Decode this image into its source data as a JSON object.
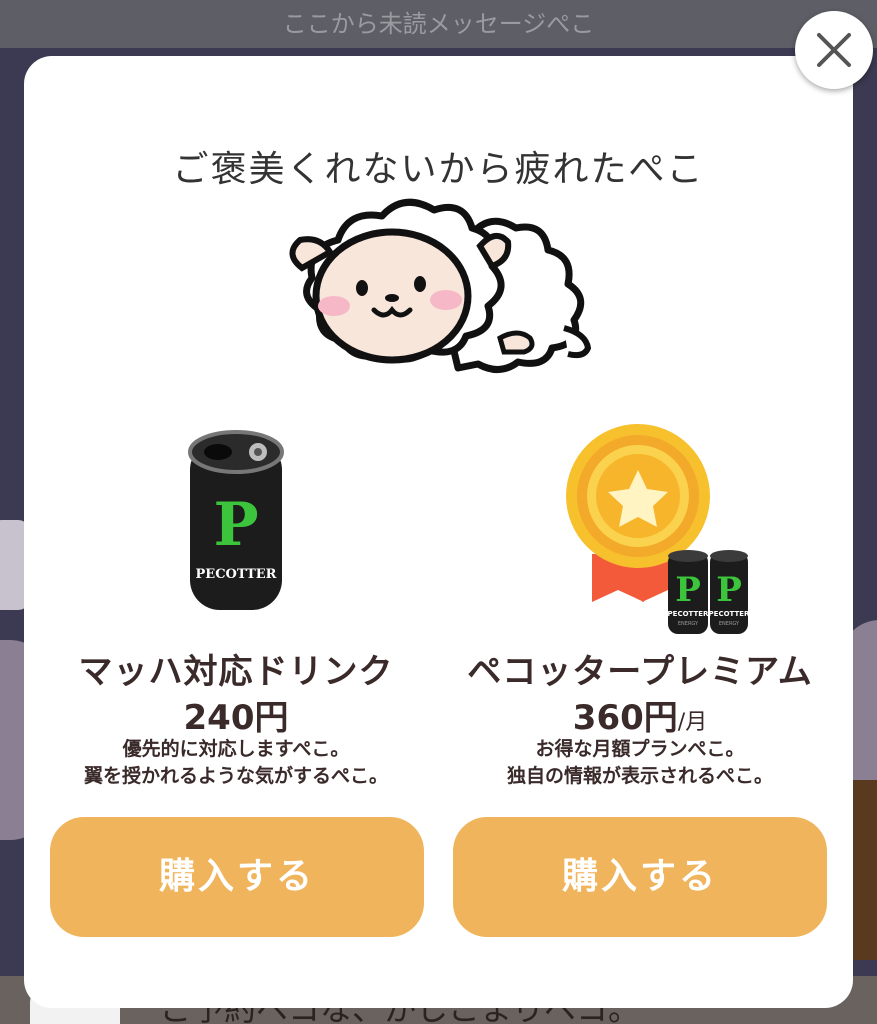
{
  "background": {
    "unread_banner": "ここから未読メッセージぺこ",
    "bottom_message": "ご予約ペコな、かしこまりペコ。"
  },
  "modal": {
    "title": "ご褒美くれないから疲れたぺこ",
    "close_icon": "close-icon",
    "products": [
      {
        "name": "マッハ対応ドリンク",
        "price": "240円",
        "unit": "",
        "description_lines": [
          "優先的に対応しますぺこ。",
          "翼を授かれるような気がするぺこ。"
        ],
        "buy_label": "購入する",
        "can_label": "PECOTTER",
        "can_letter": "P"
      },
      {
        "name": "ペコッタープレミアム",
        "price": "360円",
        "unit": "/月",
        "description_lines": [
          "お得な月額プランぺこ。",
          "独自の情報が表示されるぺこ。"
        ],
        "buy_label": "購入する",
        "can_label": "PECOTTER",
        "can_sublabel": "ENERGY",
        "can_letter": "P"
      }
    ]
  },
  "colors": {
    "button": "#f0b45c",
    "text": "#3a2a2a",
    "can_accent": "#3cc43c",
    "medal": "#f5b731"
  }
}
